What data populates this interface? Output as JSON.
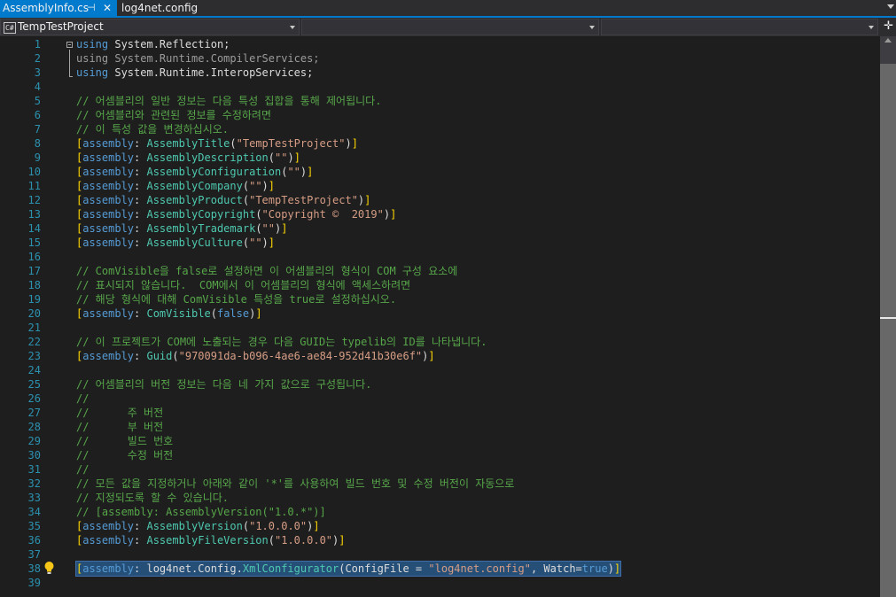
{
  "tabs": [
    {
      "label": "AssemblyInfo.cs",
      "pin_icon": "pin-icon",
      "close_icon": "close-icon",
      "active": true
    },
    {
      "label": "log4net.config",
      "active": false
    }
  ],
  "navbar": {
    "project": {
      "icon_label": "C#",
      "text": "TempTestProject"
    },
    "type": {
      "text": ""
    },
    "member": {
      "text": ""
    }
  },
  "editor": {
    "lines": [
      {
        "n": "1",
        "tokens": [
          {
            "c": "kw",
            "t": "using"
          },
          {
            "c": "pn",
            "t": " System.Reflection;"
          }
        ]
      },
      {
        "n": "2",
        "tokens": [
          {
            "c": "gr",
            "t": "using System.Runtime.CompilerServices;"
          }
        ]
      },
      {
        "n": "3",
        "tokens": [
          {
            "c": "kw",
            "t": "using"
          },
          {
            "c": "pn",
            "t": " System.Runtime.InteropServices;"
          }
        ]
      },
      {
        "n": "4",
        "tokens": []
      },
      {
        "n": "5",
        "tokens": [
          {
            "c": "cm",
            "t": "// 어셈블리의 일반 정보는 다음 특성 집합을 통해 제어됩니다."
          }
        ]
      },
      {
        "n": "6",
        "tokens": [
          {
            "c": "cm",
            "t": "// 어셈블리와 관련된 정보를 수정하려면"
          }
        ]
      },
      {
        "n": "7",
        "tokens": [
          {
            "c": "cm",
            "t": "// 이 특성 값을 변경하십시오."
          }
        ]
      },
      {
        "n": "8",
        "tokens": [
          {
            "c": "br",
            "t": "["
          },
          {
            "c": "kw",
            "t": "assembly"
          },
          {
            "c": "pn",
            "t": ": "
          },
          {
            "c": "tp",
            "t": "AssemblyTitle"
          },
          {
            "c": "pn",
            "t": "("
          },
          {
            "c": "st",
            "t": "\"TempTestProject\""
          },
          {
            "c": "pn",
            "t": ")"
          },
          {
            "c": "br",
            "t": "]"
          }
        ]
      },
      {
        "n": "9",
        "tokens": [
          {
            "c": "br",
            "t": "["
          },
          {
            "c": "kw",
            "t": "assembly"
          },
          {
            "c": "pn",
            "t": ": "
          },
          {
            "c": "tp",
            "t": "AssemblyDescription"
          },
          {
            "c": "pn",
            "t": "("
          },
          {
            "c": "st",
            "t": "\"\""
          },
          {
            "c": "pn",
            "t": ")"
          },
          {
            "c": "br",
            "t": "]"
          }
        ]
      },
      {
        "n": "10",
        "tokens": [
          {
            "c": "br",
            "t": "["
          },
          {
            "c": "kw",
            "t": "assembly"
          },
          {
            "c": "pn",
            "t": ": "
          },
          {
            "c": "tp",
            "t": "AssemblyConfiguration"
          },
          {
            "c": "pn",
            "t": "("
          },
          {
            "c": "st",
            "t": "\"\""
          },
          {
            "c": "pn",
            "t": ")"
          },
          {
            "c": "br",
            "t": "]"
          }
        ]
      },
      {
        "n": "11",
        "tokens": [
          {
            "c": "br",
            "t": "["
          },
          {
            "c": "kw",
            "t": "assembly"
          },
          {
            "c": "pn",
            "t": ": "
          },
          {
            "c": "tp",
            "t": "AssemblyCompany"
          },
          {
            "c": "pn",
            "t": "("
          },
          {
            "c": "st",
            "t": "\"\""
          },
          {
            "c": "pn",
            "t": ")"
          },
          {
            "c": "br",
            "t": "]"
          }
        ]
      },
      {
        "n": "12",
        "tokens": [
          {
            "c": "br",
            "t": "["
          },
          {
            "c": "kw",
            "t": "assembly"
          },
          {
            "c": "pn",
            "t": ": "
          },
          {
            "c": "tp",
            "t": "AssemblyProduct"
          },
          {
            "c": "pn",
            "t": "("
          },
          {
            "c": "st",
            "t": "\"TempTestProject\""
          },
          {
            "c": "pn",
            "t": ")"
          },
          {
            "c": "br",
            "t": "]"
          }
        ]
      },
      {
        "n": "13",
        "tokens": [
          {
            "c": "br",
            "t": "["
          },
          {
            "c": "kw",
            "t": "assembly"
          },
          {
            "c": "pn",
            "t": ": "
          },
          {
            "c": "tp",
            "t": "AssemblyCopyright"
          },
          {
            "c": "pn",
            "t": "("
          },
          {
            "c": "st",
            "t": "\"Copyright ©  2019\""
          },
          {
            "c": "pn",
            "t": ")"
          },
          {
            "c": "br",
            "t": "]"
          }
        ]
      },
      {
        "n": "14",
        "tokens": [
          {
            "c": "br",
            "t": "["
          },
          {
            "c": "kw",
            "t": "assembly"
          },
          {
            "c": "pn",
            "t": ": "
          },
          {
            "c": "tp",
            "t": "AssemblyTrademark"
          },
          {
            "c": "pn",
            "t": "("
          },
          {
            "c": "st",
            "t": "\"\""
          },
          {
            "c": "pn",
            "t": ")"
          },
          {
            "c": "br",
            "t": "]"
          }
        ]
      },
      {
        "n": "15",
        "tokens": [
          {
            "c": "br",
            "t": "["
          },
          {
            "c": "kw",
            "t": "assembly"
          },
          {
            "c": "pn",
            "t": ": "
          },
          {
            "c": "tp",
            "t": "AssemblyCulture"
          },
          {
            "c": "pn",
            "t": "("
          },
          {
            "c": "st",
            "t": "\"\""
          },
          {
            "c": "pn",
            "t": ")"
          },
          {
            "c": "br",
            "t": "]"
          }
        ]
      },
      {
        "n": "16",
        "tokens": []
      },
      {
        "n": "17",
        "tokens": [
          {
            "c": "cm",
            "t": "// ComVisible을 false로 설정하면 이 어셈블리의 형식이 COM 구성 요소에"
          }
        ]
      },
      {
        "n": "18",
        "tokens": [
          {
            "c": "cm",
            "t": "// 표시되지 않습니다.  COM에서 이 어셈블리의 형식에 액세스하려면"
          }
        ]
      },
      {
        "n": "19",
        "tokens": [
          {
            "c": "cm",
            "t": "// 해당 형식에 대해 ComVisible 특성을 true로 설정하십시오."
          }
        ]
      },
      {
        "n": "20",
        "tokens": [
          {
            "c": "br",
            "t": "["
          },
          {
            "c": "kw",
            "t": "assembly"
          },
          {
            "c": "pn",
            "t": ": "
          },
          {
            "c": "tp",
            "t": "ComVisible"
          },
          {
            "c": "pn",
            "t": "("
          },
          {
            "c": "kw",
            "t": "false"
          },
          {
            "c": "pn",
            "t": ")"
          },
          {
            "c": "br",
            "t": "]"
          }
        ]
      },
      {
        "n": "21",
        "tokens": []
      },
      {
        "n": "22",
        "tokens": [
          {
            "c": "cm",
            "t": "// 이 프로젝트가 COM에 노출되는 경우 다음 GUID는 typelib의 ID를 나타냅니다."
          }
        ]
      },
      {
        "n": "23",
        "tokens": [
          {
            "c": "br",
            "t": "["
          },
          {
            "c": "kw",
            "t": "assembly"
          },
          {
            "c": "pn",
            "t": ": "
          },
          {
            "c": "tp",
            "t": "Guid"
          },
          {
            "c": "pn",
            "t": "("
          },
          {
            "c": "st",
            "t": "\"970091da-b096-4ae6-ae84-952d41b30e6f\""
          },
          {
            "c": "pn",
            "t": ")"
          },
          {
            "c": "br",
            "t": "]"
          }
        ]
      },
      {
        "n": "24",
        "tokens": []
      },
      {
        "n": "25",
        "tokens": [
          {
            "c": "cm",
            "t": "// 어셈블리의 버전 정보는 다음 네 가지 값으로 구성됩니다."
          }
        ]
      },
      {
        "n": "26",
        "tokens": [
          {
            "c": "cm",
            "t": "//"
          }
        ]
      },
      {
        "n": "27",
        "tokens": [
          {
            "c": "cm",
            "t": "//      주 버전"
          }
        ]
      },
      {
        "n": "28",
        "tokens": [
          {
            "c": "cm",
            "t": "//      부 버전"
          }
        ]
      },
      {
        "n": "29",
        "tokens": [
          {
            "c": "cm",
            "t": "//      빌드 번호"
          }
        ]
      },
      {
        "n": "30",
        "tokens": [
          {
            "c": "cm",
            "t": "//      수정 버전"
          }
        ]
      },
      {
        "n": "31",
        "tokens": [
          {
            "c": "cm",
            "t": "//"
          }
        ]
      },
      {
        "n": "32",
        "tokens": [
          {
            "c": "cm",
            "t": "// 모든 값을 지정하거나 아래와 같이 '*'를 사용하여 빌드 번호 및 수정 버전이 자동으로"
          }
        ]
      },
      {
        "n": "33",
        "tokens": [
          {
            "c": "cm",
            "t": "// 지정되도록 할 수 있습니다."
          }
        ]
      },
      {
        "n": "34",
        "tokens": [
          {
            "c": "cm",
            "t": "// [assembly: AssemblyVersion(\"1.0.*\")]"
          }
        ]
      },
      {
        "n": "35",
        "tokens": [
          {
            "c": "br",
            "t": "["
          },
          {
            "c": "kw",
            "t": "assembly"
          },
          {
            "c": "pn",
            "t": ": "
          },
          {
            "c": "tp",
            "t": "AssemblyVersion"
          },
          {
            "c": "pn",
            "t": "("
          },
          {
            "c": "st",
            "t": "\"1.0.0.0\""
          },
          {
            "c": "pn",
            "t": ")"
          },
          {
            "c": "br",
            "t": "]"
          }
        ]
      },
      {
        "n": "36",
        "tokens": [
          {
            "c": "br",
            "t": "["
          },
          {
            "c": "kw",
            "t": "assembly"
          },
          {
            "c": "pn",
            "t": ": "
          },
          {
            "c": "tp",
            "t": "AssemblyFileVersion"
          },
          {
            "c": "pn",
            "t": "("
          },
          {
            "c": "st",
            "t": "\"1.0.0.0\""
          },
          {
            "c": "pn",
            "t": ")"
          },
          {
            "c": "br",
            "t": "]"
          }
        ]
      },
      {
        "n": "37",
        "tokens": []
      },
      {
        "n": "38",
        "selected": true,
        "tokens": [
          {
            "c": "br",
            "t": "["
          },
          {
            "c": "kw",
            "t": "assembly"
          },
          {
            "c": "pn",
            "t": ": log4net.Config."
          },
          {
            "c": "tp",
            "t": "XmlConfigurator"
          },
          {
            "c": "pn",
            "t": "(ConfigFile = "
          },
          {
            "c": "st",
            "t": "\"log4net.config\""
          },
          {
            "c": "pn",
            "t": ", Watch="
          },
          {
            "c": "kw",
            "t": "true"
          },
          {
            "c": "pn",
            "t": ")"
          },
          {
            "c": "br",
            "t": "]"
          }
        ]
      },
      {
        "n": "39",
        "tokens": []
      }
    ],
    "lightbulb_line": "38",
    "lightbulb_icon": "lightbulb-icon",
    "fold_icon": "collapse-icon"
  },
  "colors": {
    "background": "#1e1e1e",
    "accent": "#007acc",
    "keyword": "#569cd6",
    "comment": "#57a64a",
    "type": "#4ec9b0",
    "string": "#d69d85",
    "line_number": "#2b91af",
    "selection": "#264f78"
  }
}
